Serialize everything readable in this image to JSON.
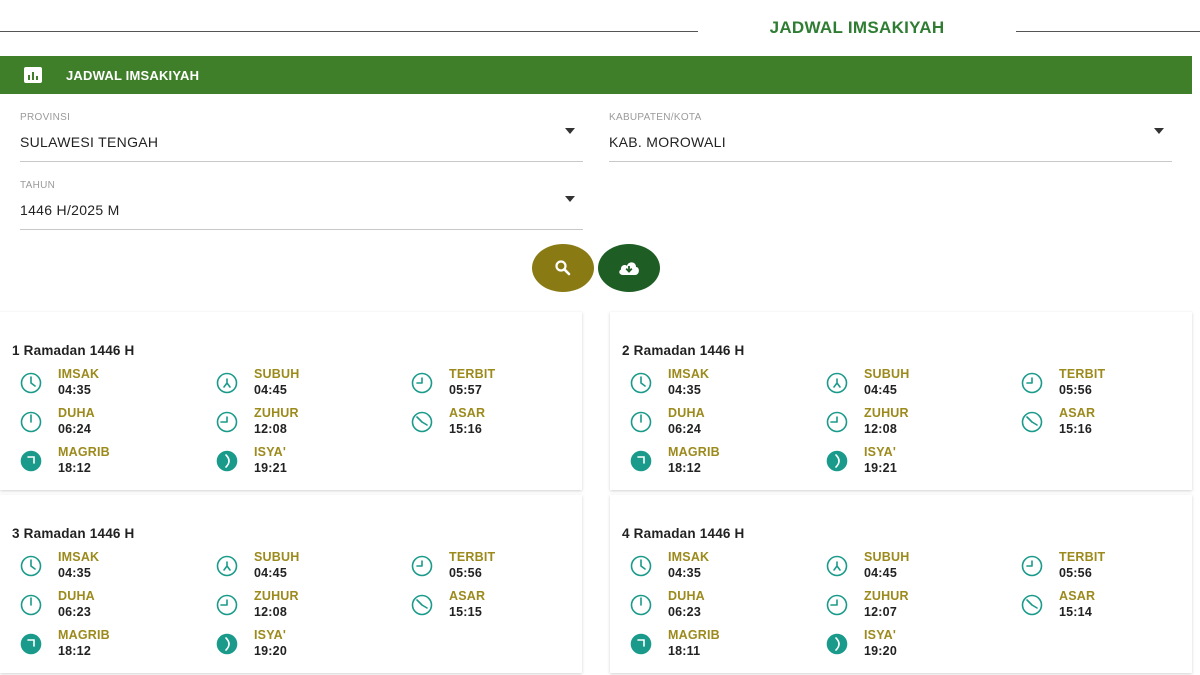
{
  "page": {
    "title": "JADWAL IMSAKIYAH"
  },
  "header_bar": {
    "icon": "bar-chart-icon",
    "title": "JADWAL IMSAKIYAH",
    "color": "#3f7f2a"
  },
  "filters": {
    "provinsi": {
      "label": "PROVINSI",
      "value": "SULAWESI TENGAH"
    },
    "kabupaten": {
      "label": "KABUPATEN/KOTA",
      "value": "KAB. MOROWALI"
    },
    "tahun": {
      "label": "TAHUN",
      "value": "1446 H/2025 M"
    }
  },
  "actions": {
    "search": {
      "icon": "search-icon",
      "color": "#8a7a14"
    },
    "download": {
      "icon": "cloud-download-icon",
      "color": "#1e5e24"
    }
  },
  "colors": {
    "label": "#9c8a1c",
    "icon_teal": "#1a9a8a"
  },
  "days": [
    {
      "title": "1 Ramadan 1446 H",
      "times": [
        {
          "label": "IMSAK",
          "time": "04:35"
        },
        {
          "label": "SUBUH",
          "time": "04:45"
        },
        {
          "label": "TERBIT",
          "time": "05:57"
        },
        {
          "label": "DUHA",
          "time": "06:24"
        },
        {
          "label": "ZUHUR",
          "time": "12:08"
        },
        {
          "label": "ASAR",
          "time": "15:16"
        },
        {
          "label": "MAGRIB",
          "time": "18:12"
        },
        {
          "label": "ISYA'",
          "time": "19:21"
        }
      ]
    },
    {
      "title": "2 Ramadan 1446 H",
      "times": [
        {
          "label": "IMSAK",
          "time": "04:35"
        },
        {
          "label": "SUBUH",
          "time": "04:45"
        },
        {
          "label": "TERBIT",
          "time": "05:56"
        },
        {
          "label": "DUHA",
          "time": "06:24"
        },
        {
          "label": "ZUHUR",
          "time": "12:08"
        },
        {
          "label": "ASAR",
          "time": "15:16"
        },
        {
          "label": "MAGRIB",
          "time": "18:12"
        },
        {
          "label": "ISYA'",
          "time": "19:21"
        }
      ]
    },
    {
      "title": "3 Ramadan 1446 H",
      "times": [
        {
          "label": "IMSAK",
          "time": "04:35"
        },
        {
          "label": "SUBUH",
          "time": "04:45"
        },
        {
          "label": "TERBIT",
          "time": "05:56"
        },
        {
          "label": "DUHA",
          "time": "06:23"
        },
        {
          "label": "ZUHUR",
          "time": "12:08"
        },
        {
          "label": "ASAR",
          "time": "15:15"
        },
        {
          "label": "MAGRIB",
          "time": "18:12"
        },
        {
          "label": "ISYA'",
          "time": "19:20"
        }
      ]
    },
    {
      "title": "4 Ramadan 1446 H",
      "times": [
        {
          "label": "IMSAK",
          "time": "04:35"
        },
        {
          "label": "SUBUH",
          "time": "04:45"
        },
        {
          "label": "TERBIT",
          "time": "05:56"
        },
        {
          "label": "DUHA",
          "time": "06:23"
        },
        {
          "label": "ZUHUR",
          "time": "12:07"
        },
        {
          "label": "ASAR",
          "time": "15:14"
        },
        {
          "label": "MAGRIB",
          "time": "18:11"
        },
        {
          "label": "ISYA'",
          "time": "19:20"
        }
      ]
    }
  ]
}
